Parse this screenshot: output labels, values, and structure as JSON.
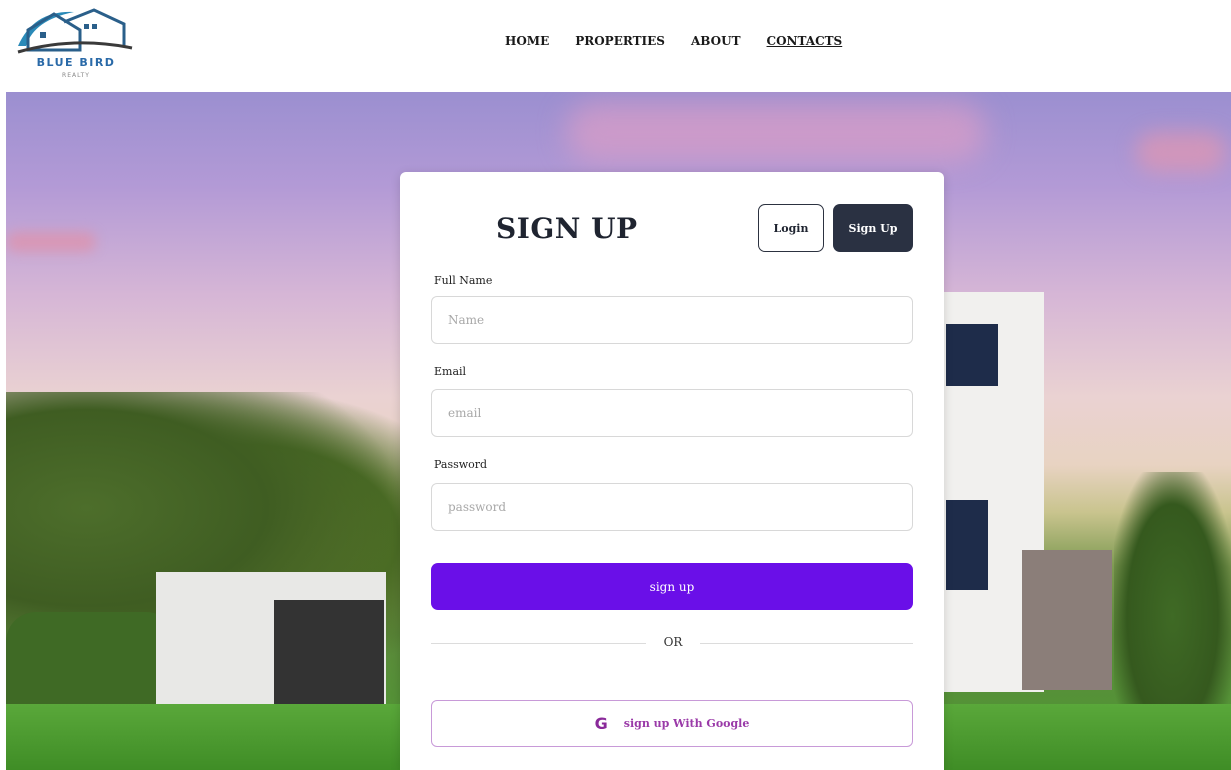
{
  "header": {
    "logo": {
      "brand": "BLUE BIRD",
      "sub": "REALTY"
    },
    "nav": [
      {
        "label": "HOME"
      },
      {
        "label": "PROPERTIES"
      },
      {
        "label": "ABOUT"
      },
      {
        "label": "CONTACTS"
      }
    ]
  },
  "form": {
    "title": "SIGN UP",
    "tabs": {
      "login": "Login",
      "signup": "Sign Up"
    },
    "fields": [
      {
        "label": "Full Name",
        "placeholder": "Name",
        "value": ""
      },
      {
        "label": "Email",
        "placeholder": "email",
        "value": ""
      },
      {
        "label": "Password",
        "placeholder": "password",
        "value": ""
      }
    ],
    "submit_label": "sign up",
    "divider_text": "OR",
    "google": {
      "icon": "google-icon",
      "glyph": "G",
      "label": "sign up With Google"
    }
  },
  "colors": {
    "primary": "#6a0fe8",
    "dark_button": "#2a3142",
    "google_accent": "#9a3aa8"
  }
}
